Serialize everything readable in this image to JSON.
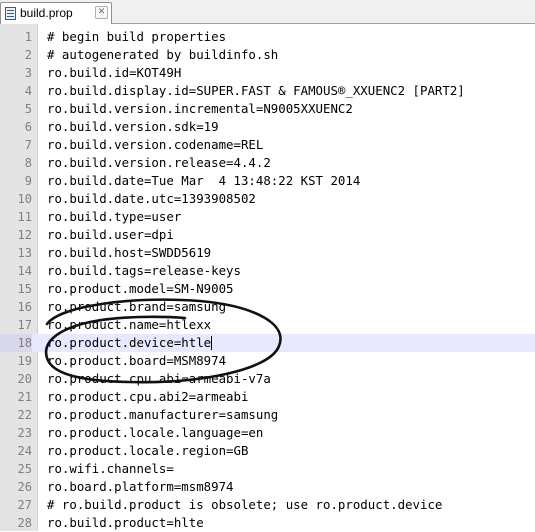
{
  "tab": {
    "title": "build.prop",
    "close_glyph": "✕"
  },
  "lines": [
    {
      "num": "1",
      "text": "# begin build properties"
    },
    {
      "num": "2",
      "text": "# autogenerated by buildinfo.sh"
    },
    {
      "num": "3",
      "text": "ro.build.id=KOT49H"
    },
    {
      "num": "4",
      "text": "ro.build.display.id=SUPER.FAST & FAMOUS®_XXUENC2 [PART2]"
    },
    {
      "num": "5",
      "text": "ro.build.version.incremental=N9005XXUENC2"
    },
    {
      "num": "6",
      "text": "ro.build.version.sdk=19"
    },
    {
      "num": "7",
      "text": "ro.build.version.codename=REL"
    },
    {
      "num": "8",
      "text": "ro.build.version.release=4.4.2"
    },
    {
      "num": "9",
      "text": "ro.build.date=Tue Mar  4 13:48:22 KST 2014"
    },
    {
      "num": "10",
      "text": "ro.build.date.utc=1393908502"
    },
    {
      "num": "11",
      "text": "ro.build.type=user"
    },
    {
      "num": "12",
      "text": "ro.build.user=dpi"
    },
    {
      "num": "13",
      "text": "ro.build.host=SWDD5619"
    },
    {
      "num": "14",
      "text": "ro.build.tags=release-keys"
    },
    {
      "num": "15",
      "text": "ro.product.model=SM-N9005"
    },
    {
      "num": "16",
      "text": "ro.product.brand=samsung"
    },
    {
      "num": "17",
      "text": "ro.product.name=htlexx"
    },
    {
      "num": "18",
      "text": "ro.product.device=htle"
    },
    {
      "num": "19",
      "text": "ro.product.board=MSM8974"
    },
    {
      "num": "20",
      "text": "ro.product.cpu.abi=armeabi-v7a"
    },
    {
      "num": "21",
      "text": "ro.product.cpu.abi2=armeabi"
    },
    {
      "num": "22",
      "text": "ro.product.manufacturer=samsung"
    },
    {
      "num": "23",
      "text": "ro.product.locale.language=en"
    },
    {
      "num": "24",
      "text": "ro.product.locale.region=GB"
    },
    {
      "num": "25",
      "text": "ro.wifi.channels="
    },
    {
      "num": "26",
      "text": "ro.board.platform=msm8974"
    },
    {
      "num": "27",
      "text": "# ro.build.product is obsolete; use ro.product.device"
    },
    {
      "num": "28",
      "text": "ro.build.product=hlte"
    }
  ],
  "current_line": 18,
  "annotation": {
    "shape": "hand-drawn-ellipse",
    "color": "#111111",
    "marks_lines": [
      "17",
      "18",
      "19"
    ]
  }
}
